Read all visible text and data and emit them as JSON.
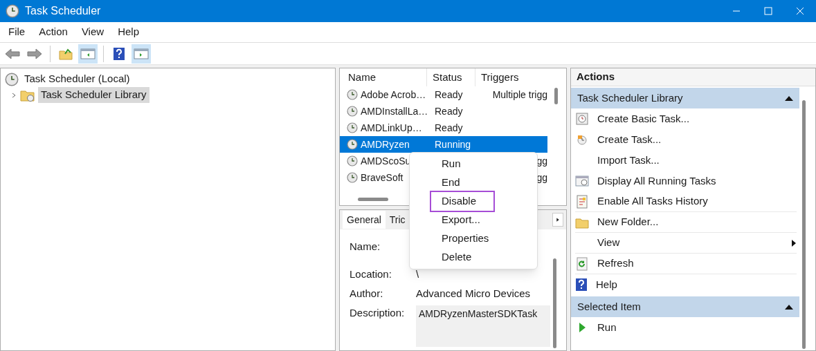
{
  "window": {
    "title": "Task Scheduler"
  },
  "menu_bar": [
    "File",
    "Action",
    "View",
    "Help"
  ],
  "toolbar": [
    {
      "kind": "back",
      "selected": false
    },
    {
      "kind": "forward",
      "selected": false
    },
    {
      "kind": "up-folder",
      "selected": false
    },
    {
      "kind": "tree-pane",
      "selected": true
    },
    {
      "kind": "help",
      "selected": false
    },
    {
      "kind": "action-pane",
      "selected": true
    }
  ],
  "tree": [
    {
      "label": "Task Scheduler (Local)",
      "selected": false,
      "children": [
        {
          "label": "Task Scheduler Library",
          "selected": true,
          "expanded": false
        }
      ]
    }
  ],
  "task_list": {
    "columns": [
      "Name",
      "Status",
      "Triggers"
    ],
    "rows": [
      {
        "name": "Adobe Acrob…",
        "status": "Ready",
        "triggers": "Multiple trigg",
        "selected": false
      },
      {
        "name": "AMDInstallLa…",
        "status": "Ready",
        "triggers": "",
        "selected": false
      },
      {
        "name": "AMDLinkUp…",
        "status": "Ready",
        "triggers": "",
        "selected": false
      },
      {
        "name": "AMDRyzen",
        "status": "Running",
        "triggers": "",
        "selected": true
      },
      {
        "name": "AMDScoSu",
        "status": "",
        "triggers": "gg",
        "selected": false
      },
      {
        "name": "BraveSoft",
        "status": "",
        "triggers": "gg",
        "selected": false
      }
    ]
  },
  "details": {
    "tabs": [
      {
        "label": "General",
        "selected": true
      },
      {
        "label": "Tric",
        "selected": false
      }
    ],
    "fields": [
      {
        "label": "Name:"
      },
      {
        "label": "Location:",
        "value": "\\"
      },
      {
        "label": "Author:",
        "value": "Advanced Micro Devices"
      },
      {
        "label": "Description:",
        "value": "AMDRyzenMasterSDKTask",
        "kind": "textarea"
      }
    ]
  },
  "context_menu": [
    {
      "label": "Run",
      "highlighted": false
    },
    {
      "label": "End",
      "highlighted": false
    },
    {
      "label": "Disable",
      "highlighted": true
    },
    {
      "label": "Export...",
      "highlighted": false
    },
    {
      "label": "Properties",
      "highlighted": false
    },
    {
      "label": "Delete",
      "highlighted": false
    }
  ],
  "actions": {
    "title": "Actions",
    "sections": [
      {
        "title": "Task Scheduler Library",
        "expanded": true,
        "items": [
          {
            "label": "Create Basic Task...",
            "kind": "basic-task",
            "submenu": false,
            "separator_below": false
          },
          {
            "label": "Create Task...",
            "kind": "task",
            "submenu": false,
            "separator_below": false
          },
          {
            "label": "Import Task...",
            "kind": "plain",
            "submenu": false,
            "separator_below": false
          },
          {
            "label": "Display All Running Tasks",
            "kind": "running",
            "submenu": false,
            "separator_below": false
          },
          {
            "label": "Enable All Tasks History",
            "kind": "history",
            "submenu": false,
            "separator_below": true
          },
          {
            "label": "New Folder...",
            "kind": "folder",
            "submenu": false,
            "separator_below": true
          },
          {
            "label": "View",
            "kind": "plain",
            "submenu": true,
            "separator_below": true
          },
          {
            "label": "Refresh",
            "kind": "refresh",
            "submenu": false,
            "separator_below": true
          },
          {
            "label": "Help",
            "kind": "help",
            "submenu": false,
            "separator_below": false
          }
        ]
      },
      {
        "title": "Selected Item",
        "expanded": true,
        "items": [
          {
            "label": "Run",
            "kind": "run",
            "submenu": false,
            "separator_below": false
          }
        ]
      }
    ]
  }
}
